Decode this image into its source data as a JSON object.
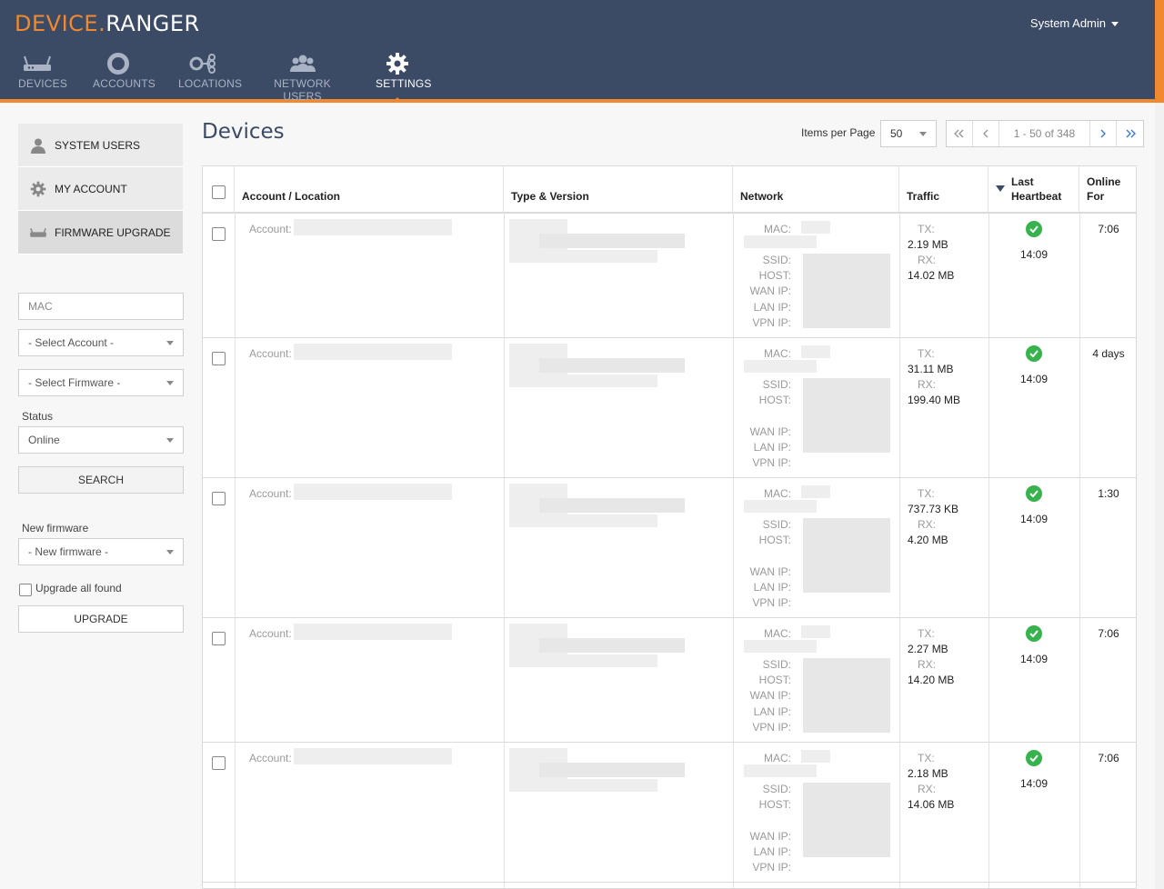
{
  "header": {
    "logo_part1": "DEVICE.",
    "logo_part2": "RANGER",
    "user_menu": "System Admin",
    "nav": [
      {
        "label": "DEVICES",
        "icon": "router-icon"
      },
      {
        "label": "ACCOUNTS",
        "icon": "ring-icon"
      },
      {
        "label": "LOCATIONS",
        "icon": "locations-icon"
      },
      {
        "label": "NETWORK USERS",
        "icon": "users-icon"
      },
      {
        "label": "SETTINGS",
        "icon": "gear-icon",
        "active": true
      }
    ]
  },
  "sidebar": {
    "menu": [
      {
        "label": "SYSTEM USERS",
        "icon": "user-icon"
      },
      {
        "label": "MY ACCOUNT",
        "icon": "gear-icon"
      },
      {
        "label": "FIRMWARE UPGRADE",
        "icon": "router-icon",
        "active": true
      }
    ],
    "mac_placeholder": "MAC",
    "account_select": "- Select Account -",
    "firmware_select": "- Select Firmware -",
    "status_label": "Status",
    "status_value": "Online",
    "search_button": "SEARCH",
    "new_firmware_label": "New firmware",
    "new_firmware_select": "- New firmware -",
    "upgrade_all_label": "Upgrade all found",
    "upgrade_button": "UPGRADE"
  },
  "main": {
    "title": "Devices",
    "items_per_page_label": "Items per Page",
    "items_per_page_value": "50",
    "pager_info": "1 - 50 of 348",
    "columns": [
      "Account / Location",
      "Type & Version",
      "Network",
      "Traffic",
      "Last Heartbeat",
      "Online For"
    ],
    "field_labels": {
      "account": "Account:",
      "mac": "MAC:",
      "ssid": "SSID:",
      "host": "HOST:",
      "wan": "WAN IP:",
      "lan": "LAN IP:",
      "vpn": "VPN IP:",
      "tx": "TX:",
      "rx": "RX:"
    },
    "rows": [
      {
        "tx": "2.19 MB",
        "rx": "14.02 MB",
        "heartbeat": "14:09",
        "online_for": "7:06"
      },
      {
        "tx": "31.11 MB",
        "rx": "199.40 MB",
        "heartbeat": "14:09",
        "online_for": "4 days"
      },
      {
        "tx": "737.73 KB",
        "rx": "4.20 MB",
        "heartbeat": "14:09",
        "online_for": "1:30"
      },
      {
        "tx": "2.27 MB",
        "rx": "14.20 MB",
        "heartbeat": "14:09",
        "online_for": "7:06"
      },
      {
        "tx": "2.18 MB",
        "rx": "14.06 MB",
        "heartbeat": "14:09",
        "online_for": "7:06"
      }
    ]
  },
  "colors": {
    "header_bg": "#3b4a65",
    "accent": "#f0892f",
    "ok_green": "#37b24d"
  }
}
